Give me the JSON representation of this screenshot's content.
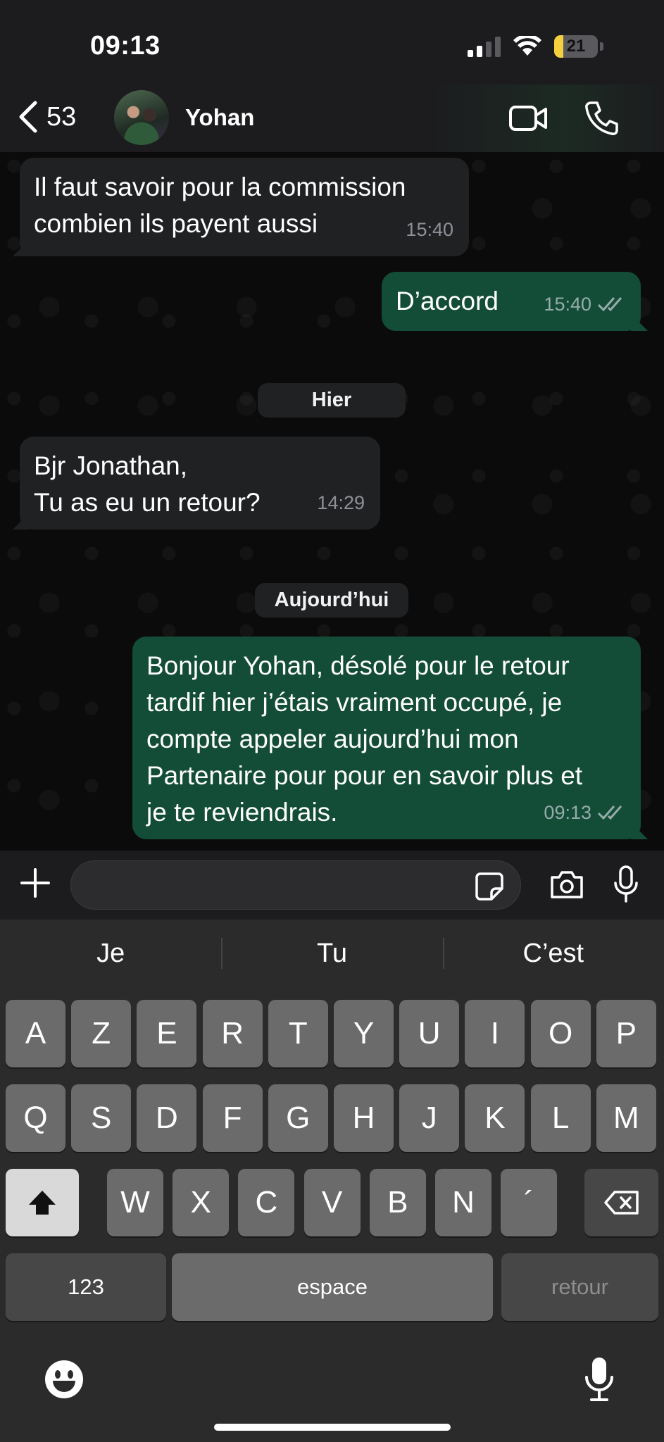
{
  "status_bar": {
    "time": "09:13",
    "battery": "21",
    "battery_level": 0.21
  },
  "header": {
    "back_count": "53",
    "contact_name": "Yohan"
  },
  "messages": [
    {
      "direction": "incoming",
      "lines": [
        "Il faut savoir pour la commission",
        "combien ils payent aussi"
      ],
      "time": "15:40"
    },
    {
      "direction": "outgoing",
      "lines": [
        "D’accord"
      ],
      "time": "15:40",
      "read": true
    },
    {
      "direction": "incoming",
      "lines": [
        "Bjr Jonathan,",
        "Tu as eu un retour?"
      ],
      "time": "14:29"
    },
    {
      "direction": "outgoing",
      "lines": [
        "Bonjour Yohan, désolé pour le retour",
        "tardif hier j’étais vraiment occupé, je",
        "compte appeler aujourd’hui mon",
        "Partenaire pour pour en savoir plus et",
        "je te reviendrais."
      ],
      "time": "09:13",
      "read": true
    }
  ],
  "date_separators": [
    "Hier",
    "Aujourd’hui"
  ],
  "composer": {
    "value": "",
    "placeholder": ""
  },
  "keyboard": {
    "suggestions": [
      "Je",
      "Tu",
      "C’est"
    ],
    "row1": [
      "A",
      "Z",
      "E",
      "R",
      "T",
      "Y",
      "U",
      "I",
      "O",
      "P"
    ],
    "row2": [
      "Q",
      "S",
      "D",
      "F",
      "G",
      "H",
      "J",
      "K",
      "L",
      "M"
    ],
    "row3": [
      "W",
      "X",
      "C",
      "V",
      "B",
      "N",
      "´"
    ],
    "numbers_key": "123",
    "space_key": "espace",
    "return_key": "retour"
  },
  "colors": {
    "outgoing_bubble": "#134d37",
    "incoming_bubble": "#1f2123",
    "battery": "#f4d03f"
  }
}
